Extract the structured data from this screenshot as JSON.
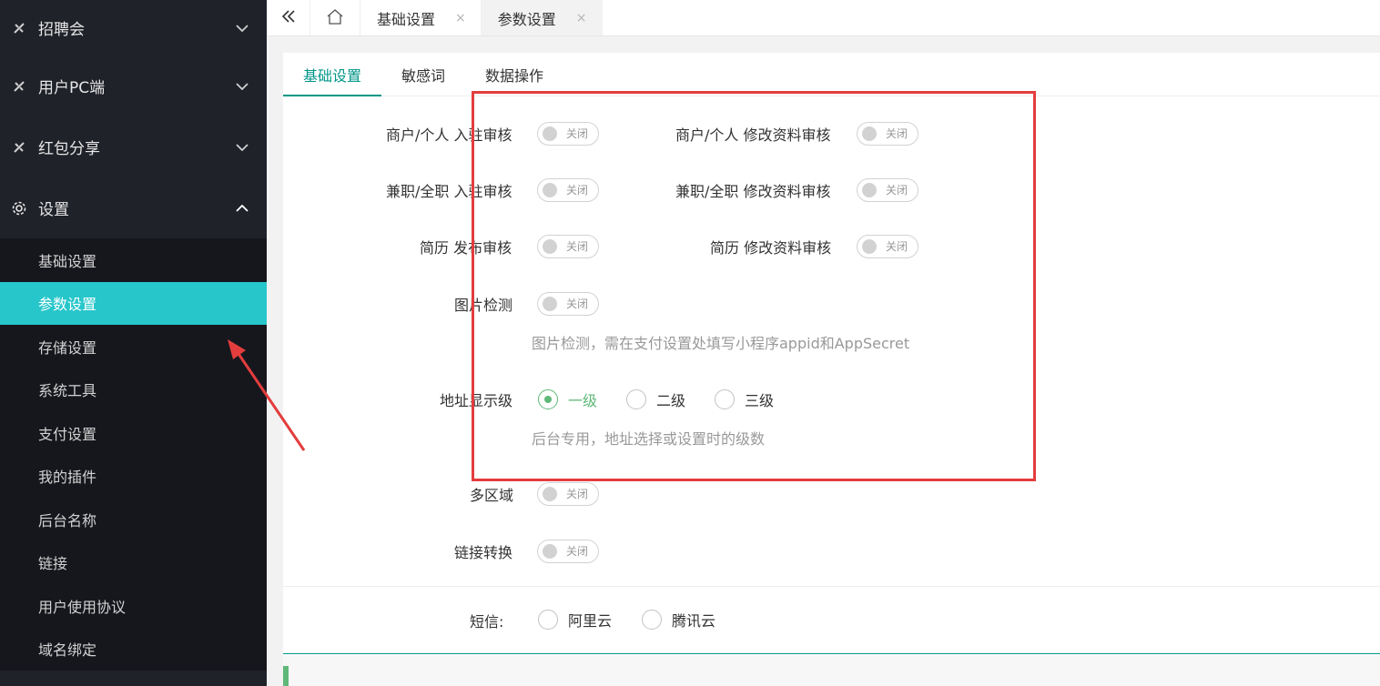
{
  "sidebar": {
    "groups": [
      {
        "label": "招聘会",
        "icon": "tools-icon",
        "expanded": false
      },
      {
        "label": "用户PC端",
        "icon": "tools-icon",
        "expanded": false
      },
      {
        "label": "红包分享",
        "icon": "tools-icon",
        "expanded": false
      },
      {
        "label": "设置",
        "icon": "gear-icon",
        "expanded": true
      }
    ],
    "sub_items": [
      {
        "label": "基础设置"
      },
      {
        "label": "参数设置",
        "active": true
      },
      {
        "label": "存储设置"
      },
      {
        "label": "系统工具"
      },
      {
        "label": "支付设置"
      },
      {
        "label": "我的插件"
      },
      {
        "label": "后台名称"
      },
      {
        "label": "链接"
      },
      {
        "label": "用户使用协议"
      },
      {
        "label": "域名绑定"
      }
    ]
  },
  "topbar": {
    "tabs": [
      {
        "label": "基础设置",
        "close": "×"
      },
      {
        "label": "参数设置",
        "close": "×",
        "active": true
      }
    ]
  },
  "subtabs": [
    {
      "label": "基础设置",
      "active": true
    },
    {
      "label": "敏感词"
    },
    {
      "label": "数据操作"
    }
  ],
  "form": {
    "merchant_join_label": "商户/个人 入驻审核",
    "merchant_edit_label": "商户/个人 修改资料审核",
    "job_join_label": "兼职/全职 入驻审核",
    "job_edit_label": "兼职/全职 修改资料审核",
    "resume_publish_label": "简历 发布审核",
    "resume_edit_label": "简历 修改资料审核",
    "image_check_label": "图片检测",
    "image_check_hint": "图片检测，需在支付设置处填写小程序appid和AppSecret",
    "address_level_label": "地址显示级",
    "address_levels": [
      "一级",
      "二级",
      "三级"
    ],
    "address_level_selected": "一级",
    "address_level_hint": "后台专用，地址选择或设置时的级数",
    "multi_region_label": "多区域",
    "link_convert_label": "链接转换",
    "switch_off_text": "关闭",
    "sms_label": "短信:",
    "sms_options": [
      "阿里云",
      "腾讯云"
    ]
  },
  "colors": {
    "sidebar_bg": "#20222a",
    "active_item": "#26c6ca",
    "accent_green": "#009688",
    "radio_green": "#5fb878",
    "annotation_red": "#e43d3d"
  }
}
